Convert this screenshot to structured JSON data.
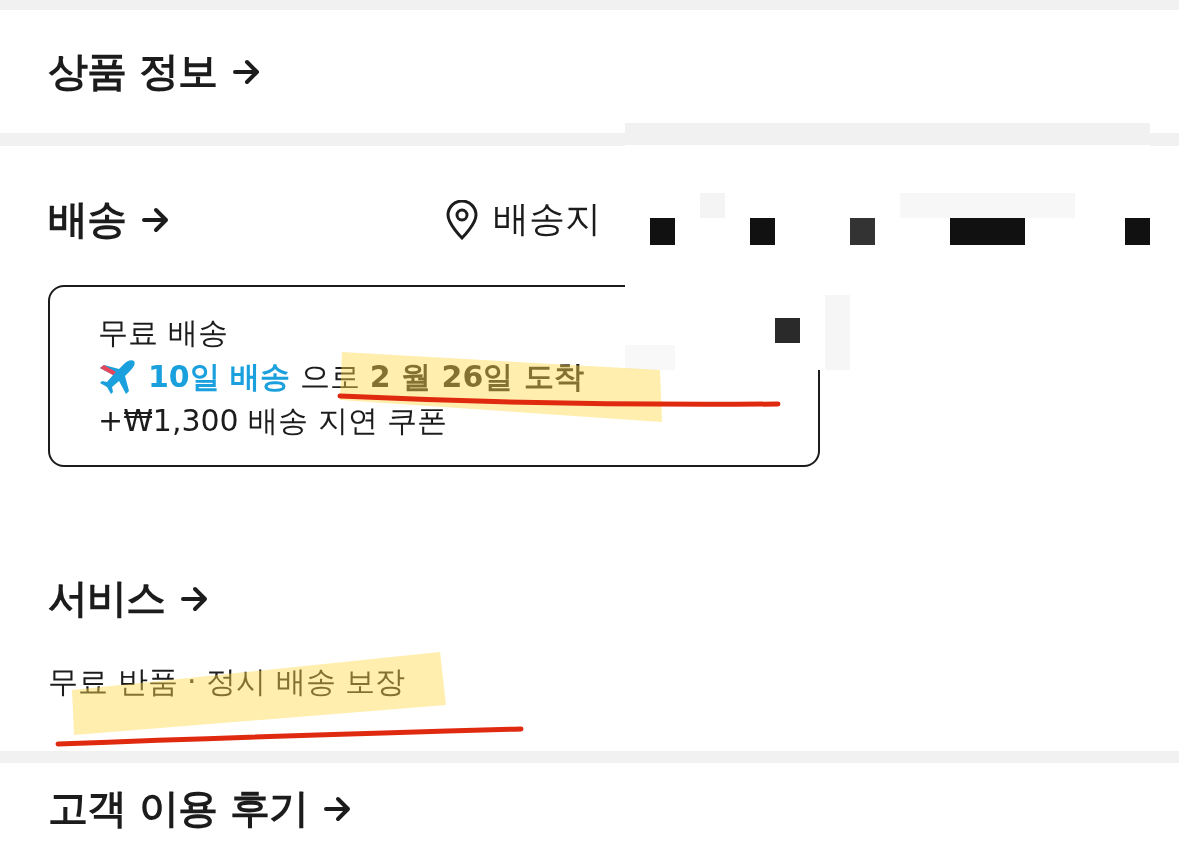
{
  "sections": [
    {
      "kind": "plain",
      "title": "상품 정보"
    },
    {
      "kind": "shipping",
      "title": "배송",
      "destination_label": "배송지",
      "card": {
        "title": "무료 배송",
        "speed": "10일 배송",
        "arrival": "으로 **2 월 26일 도착**",
        "coupon": "+₩1,300 배송 지연 쿠폰"
      }
    },
    {
      "kind": "service",
      "title": "서비스",
      "text": "무료 반품 · 정시 배송 보장"
    },
    {
      "kind": "plain",
      "title": "고객 이용 후기"
    }
  ]
}
